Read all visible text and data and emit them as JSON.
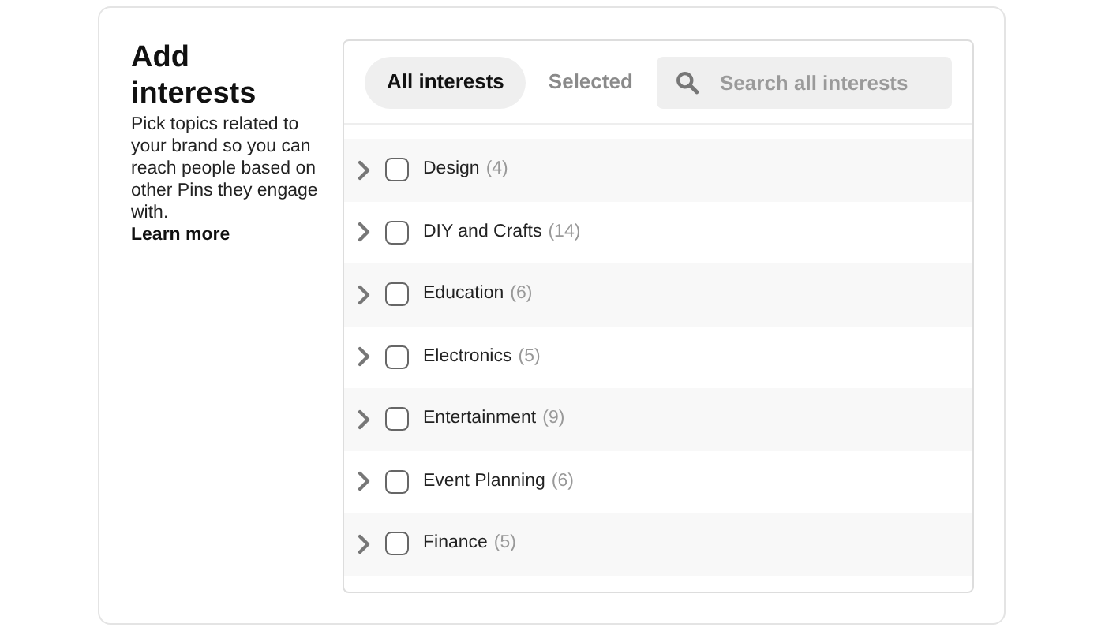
{
  "intro": {
    "title": "Add interests",
    "description": "Pick topics related to your brand so you can reach people based on other Pins they engage with.",
    "link": "Learn more"
  },
  "tabs": [
    {
      "label": "All interests",
      "selected": true
    },
    {
      "label": "Selected",
      "selected": false
    }
  ],
  "search": {
    "placeholder": "Search all interests"
  },
  "interests": [
    {
      "name": "Design",
      "count": "(4)",
      "checked": false
    },
    {
      "name": "DIY and Crafts",
      "count": "(14)",
      "checked": false
    },
    {
      "name": "Education",
      "count": "(6)",
      "checked": false
    },
    {
      "name": "Electronics",
      "count": "(5)",
      "checked": false
    },
    {
      "name": "Entertainment",
      "count": "(9)",
      "checked": false
    },
    {
      "name": "Event Planning",
      "count": "(6)",
      "checked": false
    },
    {
      "name": "Finance",
      "count": "(5)",
      "checked": false
    }
  ]
}
